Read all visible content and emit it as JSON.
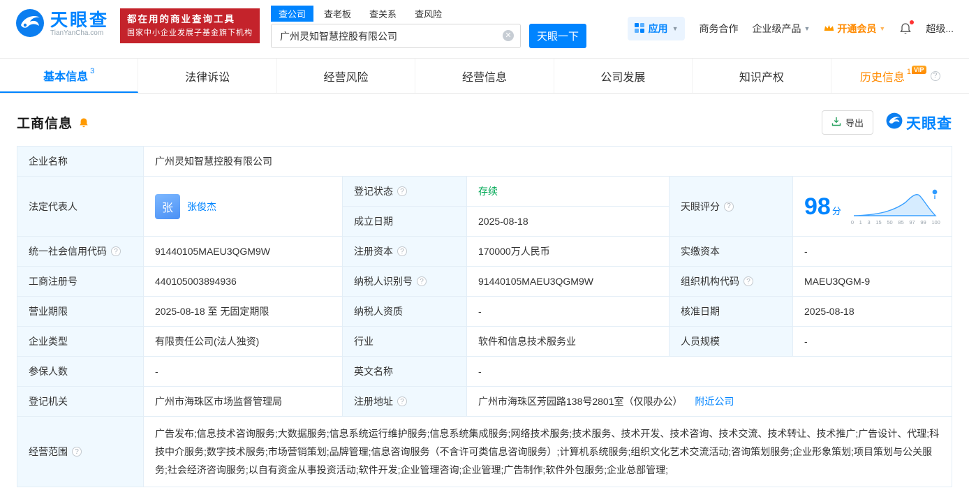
{
  "header": {
    "logo": {
      "cn": "天眼查",
      "en": "TianYanCha.com"
    },
    "promo": {
      "line1": "都在用的商业查询工具",
      "line2": "国家中小企业发展子基金旗下机构"
    },
    "search": {
      "tabs": [
        {
          "label": "查公司"
        },
        {
          "label": "查老板"
        },
        {
          "label": "查关系"
        },
        {
          "label": "查风险"
        }
      ],
      "value": "广州灵知智慧控股有限公司",
      "button": "天眼一下"
    },
    "nav": {
      "apps": "应用",
      "cooperation": "商务合作",
      "enterprise": "企业级产品",
      "vip": "开通会员",
      "user": "超级..."
    }
  },
  "tabs": [
    {
      "label": "基本信息",
      "count": "3"
    },
    {
      "label": "法律诉讼"
    },
    {
      "label": "经营风险"
    },
    {
      "label": "经营信息"
    },
    {
      "label": "公司发展"
    },
    {
      "label": "知识产权"
    },
    {
      "label": "历史信息",
      "count": "1",
      "badge": "VIP"
    }
  ],
  "section": {
    "title": "工商信息",
    "export_label": "导出",
    "brand": "天眼查"
  },
  "info": {
    "company_name": {
      "label": "企业名称",
      "value": "广州灵知智慧控股有限公司"
    },
    "legal_rep": {
      "label": "法定代表人",
      "avatar": "张",
      "value": "张俊杰"
    },
    "reg_status": {
      "label": "登记状态",
      "value": "存续"
    },
    "est_date": {
      "label": "成立日期",
      "value": "2025-08-18"
    },
    "score": {
      "label": "天眼评分",
      "value": "98",
      "unit": "分",
      "ticks": [
        "0",
        "1",
        "3",
        "15",
        "50",
        "85",
        "97",
        "99",
        "100"
      ]
    },
    "credit_code": {
      "label": "统一社会信用代码",
      "value": "91440105MAEU3QGM9W"
    },
    "reg_capital": {
      "label": "注册资本",
      "value": "170000万人民币"
    },
    "paid_capital": {
      "label": "实缴资本",
      "value": "-"
    },
    "reg_number": {
      "label": "工商注册号",
      "value": "440105003894936"
    },
    "taxpayer_id": {
      "label": "纳税人识别号",
      "value": "91440105MAEU3QGM9W"
    },
    "org_code": {
      "label": "组织机构代码",
      "value": "MAEU3QGM-9"
    },
    "business_term": {
      "label": "营业期限",
      "value": "2025-08-18 至 无固定期限"
    },
    "taxpayer_quality": {
      "label": "纳税人资质",
      "value": "-"
    },
    "approval_date": {
      "label": "核准日期",
      "value": "2025-08-18"
    },
    "company_type": {
      "label": "企业类型",
      "value": "有限责任公司(法人独资)"
    },
    "industry": {
      "label": "行业",
      "value": "软件和信息技术服务业"
    },
    "staff_size": {
      "label": "人员规模",
      "value": "-"
    },
    "insured_count": {
      "label": "参保人数",
      "value": "-"
    },
    "english_name": {
      "label": "英文名称",
      "value": "-"
    },
    "reg_authority": {
      "label": "登记机关",
      "value": "广州市海珠区市场监督管理局"
    },
    "reg_address": {
      "label": "注册地址",
      "value": "广州市海珠区芳园路138号2801室（仅限办公）",
      "link": "附近公司"
    },
    "business_scope": {
      "label": "经营范围",
      "value": "广告发布;信息技术咨询服务;大数据服务;信息系统运行维护服务;信息系统集成服务;网络技术服务;技术服务、技术开发、技术咨询、技术交流、技术转让、技术推广;广告设计、代理;科技中介服务;数字技术服务;市场营销策划;品牌管理;信息咨询服务（不含许可类信息咨询服务）;计算机系统服务;组织文化艺术交流活动;咨询策划服务;企业形象策划;项目策划与公关服务;社会经济咨询服务;以自有资金从事投资活动;软件开发;企业管理咨询;企业管理;广告制作;软件外包服务;企业总部管理;"
    }
  }
}
